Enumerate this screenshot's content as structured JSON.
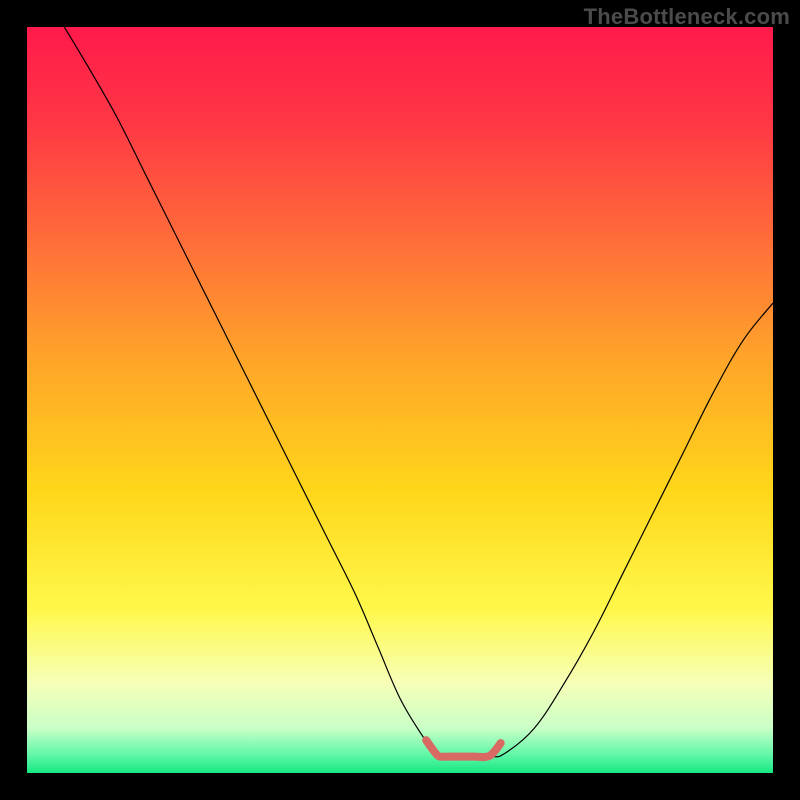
{
  "watermark": "TheBottleneck.com",
  "chart_data": {
    "type": "line",
    "title": "",
    "xlabel": "",
    "ylabel": "",
    "xlim": [
      0,
      100
    ],
    "ylim": [
      0,
      100
    ],
    "grid": false,
    "legend": false,
    "background": {
      "type": "vertical-gradient",
      "stops": [
        {
          "offset": 0.0,
          "color": "#ff1a4b"
        },
        {
          "offset": 0.12,
          "color": "#ff3545"
        },
        {
          "offset": 0.28,
          "color": "#ff6b3a"
        },
        {
          "offset": 0.45,
          "color": "#ffa629"
        },
        {
          "offset": 0.62,
          "color": "#ffd61a"
        },
        {
          "offset": 0.78,
          "color": "#fff84a"
        },
        {
          "offset": 0.88,
          "color": "#f6ffb8"
        },
        {
          "offset": 0.94,
          "color": "#c9ffc7"
        },
        {
          "offset": 0.975,
          "color": "#62f7a8"
        },
        {
          "offset": 1.0,
          "color": "#17e884"
        }
      ]
    },
    "series": [
      {
        "name": "bottleneck-curve",
        "color": "#000000",
        "width": 1.2,
        "x": [
          5,
          8,
          12,
          16,
          20,
          24,
          28,
          32,
          36,
          40,
          44,
          47,
          50,
          53,
          55,
          58,
          62,
          64,
          68,
          72,
          76,
          80,
          84,
          88,
          92,
          96,
          100
        ],
        "y": [
          100,
          95,
          88,
          80,
          72,
          64,
          56,
          48,
          40,
          32,
          24,
          17,
          10,
          5,
          2.4,
          2.2,
          2.2,
          2.6,
          6,
          12,
          19,
          27,
          35,
          43,
          51,
          58,
          63
        ]
      },
      {
        "name": "optimal-flat-region",
        "color": "#d86a63",
        "width": 8,
        "linecap": "round",
        "x": [
          53.5,
          55,
          56,
          57,
          58,
          60,
          62,
          63.5
        ],
        "y": [
          4.4,
          2.4,
          2.2,
          2.2,
          2.2,
          2.2,
          2.3,
          4.0
        ]
      }
    ]
  }
}
